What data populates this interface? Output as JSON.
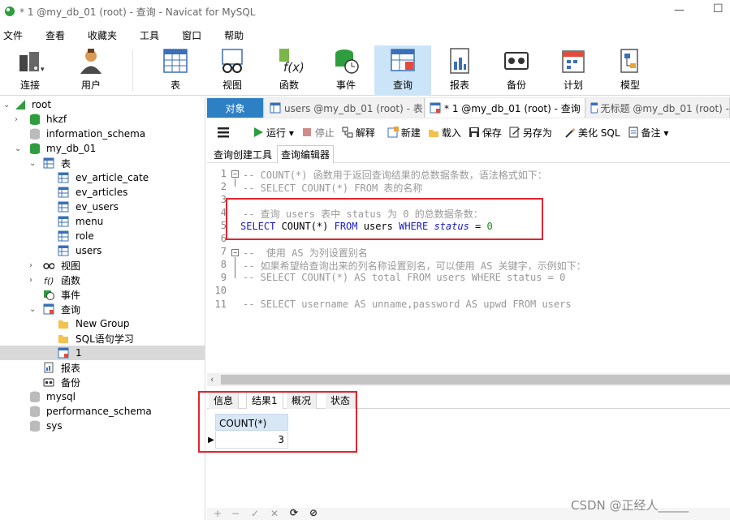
{
  "window": {
    "title": "* 1 @my_db_01 (root) - 查询 - Navicat for MySQL",
    "minimize": "—",
    "maximize": "☐"
  },
  "menu": [
    "文件",
    "查看",
    "收藏夹",
    "工具",
    "窗口",
    "帮助"
  ],
  "toolbar": [
    {
      "label": "连接",
      "icon": "connect-icon"
    },
    {
      "label": "用户",
      "icon": "user-icon"
    },
    {
      "label": "表",
      "icon": "table-icon"
    },
    {
      "label": "视图",
      "icon": "view-icon"
    },
    {
      "label": "函数",
      "icon": "function-icon"
    },
    {
      "label": "事件",
      "icon": "event-icon"
    },
    {
      "label": "查询",
      "icon": "query-icon"
    },
    {
      "label": "报表",
      "icon": "report-icon"
    },
    {
      "label": "备份",
      "icon": "backup-icon"
    },
    {
      "label": "计划",
      "icon": "schedule-icon"
    },
    {
      "label": "模型",
      "icon": "model-icon"
    }
  ],
  "sidebar": {
    "items": [
      {
        "label": "root"
      },
      {
        "label": "hkzf"
      },
      {
        "label": "information_schema"
      },
      {
        "label": "my_db_01"
      },
      {
        "label": "表"
      },
      {
        "label": "ev_article_cate"
      },
      {
        "label": "ev_articles"
      },
      {
        "label": "ev_users"
      },
      {
        "label": "menu"
      },
      {
        "label": "role"
      },
      {
        "label": "users"
      },
      {
        "label": "视图"
      },
      {
        "label": "函数"
      },
      {
        "label": "事件"
      },
      {
        "label": "查询"
      },
      {
        "label": "New Group"
      },
      {
        "label": "SQL语句学习"
      },
      {
        "label": "1"
      },
      {
        "label": "报表"
      },
      {
        "label": "备份"
      },
      {
        "label": "mysql"
      },
      {
        "label": "performance_schema"
      },
      {
        "label": "sys"
      }
    ]
  },
  "tabs": [
    {
      "label": "对象"
    },
    {
      "label": "users @my_db_01 (root) - 表"
    },
    {
      "label": "* 1 @my_db_01 (root) - 查询"
    },
    {
      "label": "无标题 @my_db_01 (root) -"
    }
  ],
  "actions": [
    {
      "label": "",
      "icon": "menu-icon"
    },
    {
      "label": "运行 ▾",
      "icon": "run-icon"
    },
    {
      "label": "停止",
      "icon": "stop-icon"
    },
    {
      "label": "解释",
      "icon": "explain-icon"
    },
    {
      "label": "新建",
      "icon": "new-icon"
    },
    {
      "label": "载入",
      "icon": "load-icon"
    },
    {
      "label": "保存",
      "icon": "save-icon"
    },
    {
      "label": "另存为",
      "icon": "save-as-icon"
    },
    {
      "label": "美化 SQL",
      "icon": "beautify-icon"
    },
    {
      "label": "备注 ▾",
      "icon": "note-icon"
    }
  ],
  "subtabs": [
    "查询创建工具",
    "查询编辑器"
  ],
  "editor": {
    "line_numbers": [
      "1",
      "2",
      "3",
      "4",
      "5",
      "6",
      "7",
      "8",
      "9",
      "10",
      "11"
    ],
    "lines": {
      "l1": "-- COUNT(*) 函数用于返回查询结果的总数据条数，语法格式如下：",
      "l2": "-- SELECT COUNT(*) FROM 表的名称",
      "l4": "-- 查询 users 表中 status 为 0 的总数据条数：",
      "l5_kw1": "SELECT",
      "l5_a": " COUNT(*) ",
      "l5_kw2": "FROM",
      "l5_b": " users ",
      "l5_kw3": "WHERE",
      "l5_c": " ",
      "l5_col": "status",
      "l5_d": " = ",
      "l5_num": "0",
      "l7": "--  使用 AS 为列设置别名",
      "l8": "-- 如果希望给查询出来的列名称设置别名，可以使用 AS 关键字，示例如下：",
      "l9": "-- SELECT COUNT(*) AS total FROM users WHERE status = 0",
      "l11": "-- SELECT username AS unname,password AS upwd FROM users"
    }
  },
  "result_tabs": [
    "信息",
    "结果1",
    "概况",
    "状态"
  ],
  "result": {
    "column": "COUNT(*)",
    "value": "3",
    "row_marker": "▶"
  },
  "bottom_controls": [
    "+",
    "−",
    "✓",
    "✕",
    "⟳",
    "⊘"
  ],
  "watermark": "CSDN @正经人_____",
  "colors": {
    "accent": "#2e80c5",
    "highlight_box": "#e0262f",
    "keyword": "#1a1acc",
    "comment": "#999999",
    "active_tool": "#cce4f7"
  }
}
